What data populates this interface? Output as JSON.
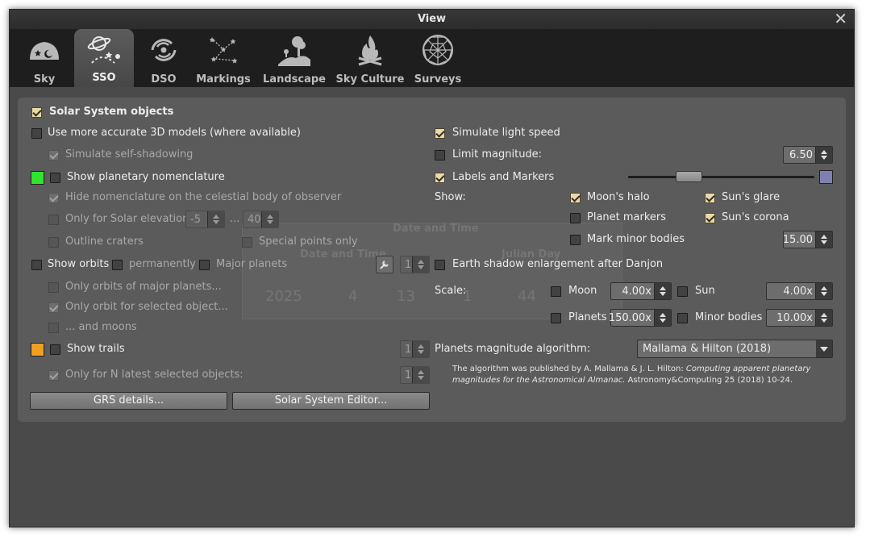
{
  "window": {
    "title": "View",
    "close_glyph": "✕"
  },
  "tabs": [
    {
      "label": "Sky",
      "icon": "sky-icon"
    },
    {
      "label": "SSO",
      "icon": "sso-icon",
      "active": true
    },
    {
      "label": "DSO",
      "icon": "galaxy-icon"
    },
    {
      "label": "Markings",
      "icon": "constellation-icon"
    },
    {
      "label": "Landscape",
      "icon": "landscape-icon"
    },
    {
      "label": "Sky Culture",
      "icon": "campfire-icon"
    },
    {
      "label": "Surveys",
      "icon": "sphere-icon"
    }
  ],
  "background_dialog": {
    "title": "Date and Time",
    "date_time_label": "Date and Time",
    "julian_day_label": "Julian Day",
    "year": "2025",
    "month": "4",
    "day": "13",
    "hour": "1",
    "minute": "44"
  },
  "left": {
    "solar_system_objects": {
      "label": "Solar System objects",
      "checked": true
    },
    "accurate_3d": {
      "label": "Use more accurate 3D models (where available)",
      "checked": false
    },
    "self_shadowing": {
      "label": "Simulate self-shadowing",
      "checked": true
    },
    "nomenclature": {
      "label": "Show planetary nomenclature",
      "checked": false,
      "color": "#2ee62e"
    },
    "hide_nomenclature": {
      "label": "Hide nomenclature on the celestial body of observer",
      "checked": true
    },
    "solar_elevation": {
      "label": "Only for Solar elevation",
      "min": "-5",
      "sep": "...",
      "max": "40"
    },
    "outline_craters": {
      "label": "Outline craters"
    },
    "special_points": {
      "label": "Special points only"
    },
    "show_orbits": {
      "label": "Show orbits",
      "permanently": "permanently",
      "major_planets": "Major planets",
      "thickness": "1"
    },
    "orbits_major": {
      "label": "Only orbits of major planets..."
    },
    "orbit_selected": {
      "label": "Only orbit for selected object...",
      "checked": true
    },
    "and_moons": {
      "label": "... and moons"
    },
    "show_trails": {
      "label": "Show trails",
      "color": "#f0a020",
      "value": "1"
    },
    "latest_selected": {
      "label": "Only for N latest selected objects:",
      "checked": true,
      "value": "1"
    },
    "grs_button": "GRS details...",
    "editor_button": "Solar System Editor..."
  },
  "right": {
    "light_speed": {
      "label": "Simulate light speed",
      "checked": true
    },
    "limit_magnitude": {
      "label": "Limit magnitude:",
      "value": "6.50"
    },
    "labels_markers": {
      "label": "Labels and Markers",
      "checked": true,
      "slider": 0.22,
      "color": "#8080b0"
    },
    "show_label": "Show:",
    "moons_halo": {
      "label": "Moon's halo",
      "checked": true
    },
    "suns_glare": {
      "label": "Sun's glare",
      "checked": true
    },
    "planet_markers": {
      "label": "Planet markers",
      "checked": false
    },
    "suns_corona": {
      "label": "Sun's corona",
      "checked": true
    },
    "minor_bodies_mark": {
      "label": "Mark minor bodies",
      "value": "15.00"
    },
    "earth_shadow": {
      "label": "Earth shadow enlargement after Danjon"
    },
    "scale_label": "Scale:",
    "scale_moon": {
      "label": "Moon",
      "value": "4.00x"
    },
    "scale_sun": {
      "label": "Sun",
      "value": "4.00x"
    },
    "scale_planets": {
      "label": "Planets",
      "value": "150.00x"
    },
    "scale_minor": {
      "label": "Minor bodies",
      "value": "10.00x"
    },
    "magnitude_algorithm": {
      "label": "Planets magnitude algorithm:",
      "value": "Mallama & Hilton (2018)"
    },
    "algorithm_text_a": "The algorithm was published by A. Mallama & J. L. Hilton: ",
    "algorithm_text_italic": "Computing apparent planetary magnitudes for the Astronomical Almanac.",
    "algorithm_text_b": " Astronomy&Computing 25 (2018) 10-24."
  }
}
